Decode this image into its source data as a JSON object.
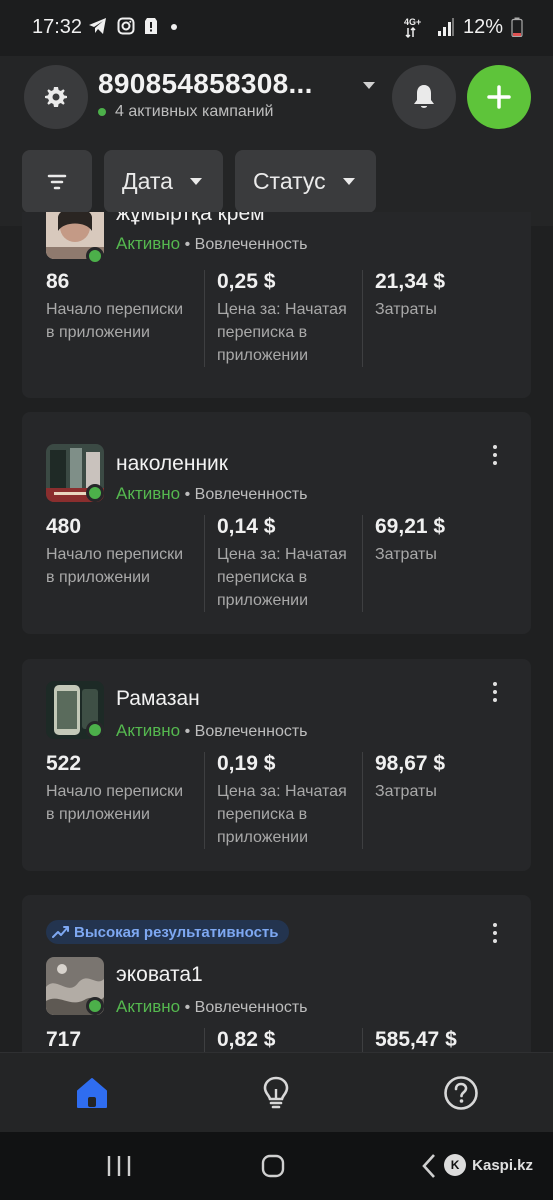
{
  "status_bar": {
    "time": "17:32",
    "network": "4G+",
    "battery": "12%"
  },
  "header": {
    "account_title": "890854858308...",
    "active_campaigns": "4 активных кампаний",
    "filters": [
      {
        "label": "Дата"
      },
      {
        "label": "Статус"
      }
    ],
    "icons": {
      "settings": "gear-icon",
      "notifications": "bell-icon",
      "add": "plus-icon",
      "filter": "filter-icon"
    },
    "accent_color": "#5ec43a"
  },
  "campaigns": [
    {
      "name": "жұмыртқа крем",
      "status": "Активно",
      "objective": "Вовлеченность",
      "metrics": [
        {
          "value": "86",
          "label": "Начало переписки в приложении"
        },
        {
          "value": "0,25 $",
          "label": "Цена за: Начатая переписка в приложении"
        },
        {
          "value": "21,34 $",
          "label": "Затраты"
        }
      ]
    },
    {
      "name": "наколенник",
      "status": "Активно",
      "objective": "Вовлеченность",
      "metrics": [
        {
          "value": "480",
          "label": "Начало переписки в приложении"
        },
        {
          "value": "0,14 $",
          "label": "Цена за: Начатая переписка в приложении"
        },
        {
          "value": "69,21 $",
          "label": "Затраты"
        }
      ]
    },
    {
      "name": "Рамазан",
      "status": "Активно",
      "objective": "Вовлеченность",
      "metrics": [
        {
          "value": "522",
          "label": "Начало переписки в приложении"
        },
        {
          "value": "0,19 $",
          "label": "Цена за: Начатая переписка в приложении"
        },
        {
          "value": "98,67 $",
          "label": "Затраты"
        }
      ]
    },
    {
      "badge": "Высокая результативность",
      "name": "эковата1",
      "status": "Активно",
      "objective": "Вовлеченность",
      "metrics": [
        {
          "value": "717",
          "label": ""
        },
        {
          "value": "0,82 $",
          "label": ""
        },
        {
          "value": "585,47 $",
          "label": ""
        }
      ]
    }
  ],
  "separator": "•",
  "bottom_nav": [
    {
      "icon": "home-icon",
      "active": true
    },
    {
      "icon": "lightbulb-icon",
      "active": false
    },
    {
      "icon": "help-icon",
      "active": false
    }
  ],
  "system_nav": {
    "watermark": "Kaspi.kz"
  }
}
